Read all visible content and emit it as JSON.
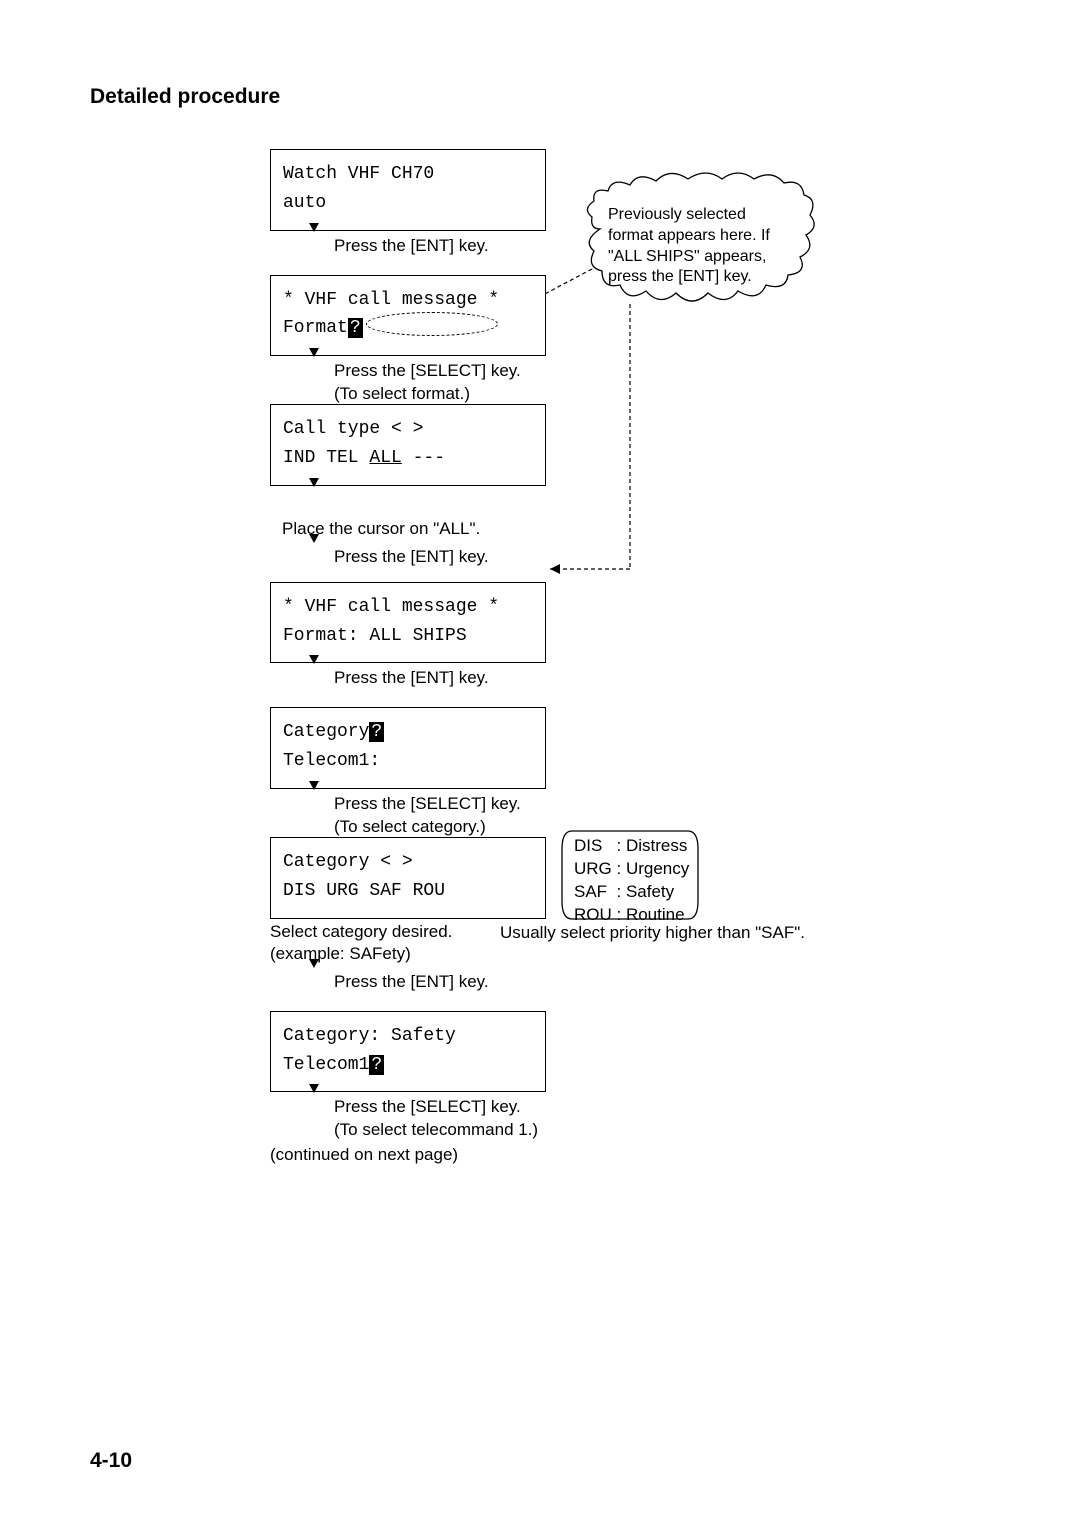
{
  "heading": "Detailed procedure",
  "screens": {
    "s1_l1": "Watch VHF CH70",
    "s1_l2": "auto",
    "s2_l1": "* VHF call message *",
    "s2_l2a": "Format",
    "s2_l2b": "?",
    "s3_l1": "Call type <     >",
    "s3_l2a": "IND TEL ",
    "s3_l2b": "ALL",
    "s3_l2c": " ---",
    "s4_l1": "* VHF call message *",
    "s4_l2": "Format: ALL SHIPS",
    "s5_l1a": "Category",
    "s5_l1b": "?",
    "s5_l2": "Telecom1:",
    "s6_l1": "Category <     >",
    "s6_l2": "DIS URG SAF ROU",
    "s7_l1": "Category: Safety",
    "s7_l2a": "Telecom1",
    "s7_l2b": "?"
  },
  "arrows": {
    "a1": "Press the [ENT] key.",
    "a2_l1": "Press the [SELECT] key.",
    "a2_l2": "(To select format.)",
    "a4": "Press the [ENT] key.",
    "a5": "Press the [ENT] key.",
    "a6_l1": "Press the [SELECT] key.",
    "a6_l2": "(To select category.)",
    "a8": "Press the [ENT] key.",
    "a9_l1": "Press the [SELECT] key.",
    "a9_l2": "(To select telecommand 1.)"
  },
  "instructions": {
    "place_cursor": "Place the cursor on \"ALL\".",
    "select_cat_l1": "Select category desired.",
    "select_cat_l2": "(example: SAFety)",
    "continued": "(continued on next page)"
  },
  "cloud": {
    "l1": "Previously selected",
    "l2": "format appears here. If",
    "l3": "\"ALL SHIPS\" appears,",
    "l4": "press the [ENT] key."
  },
  "legend": "DIS   : Distress\nURG : Urgency\nSAF  : Safety\nROU : Routine",
  "side_note": "Usually select priority higher than \"SAF\".",
  "page_num": "4-10"
}
